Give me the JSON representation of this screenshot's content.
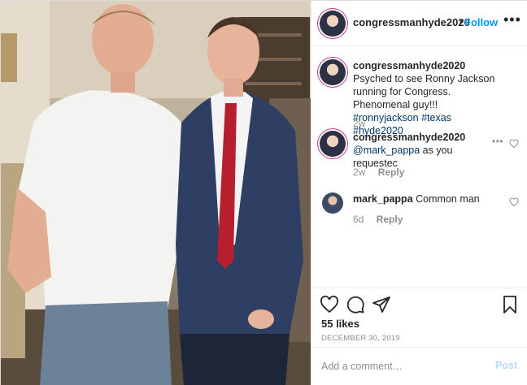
{
  "post": {
    "author": "congressmanhyde2020",
    "separator": "•",
    "follow_label": "Follow",
    "more_label": "•••",
    "photo_alt": "photo"
  },
  "comments": [
    {
      "username": "congressmanhyde2020",
      "text": "Psyched to see Ronny Jackson running for Congress. Phenomenal guy!!!",
      "hashtags": "#ronnyjackson #texas #hyde2020",
      "age": "2w"
    },
    {
      "username": "congressmanhyde2020",
      "mention": "@mark_pappa",
      "text": "as you requestec",
      "age": "2w",
      "reply_label": "Reply",
      "more_label": "•••"
    },
    {
      "username": "mark_pappa",
      "text": "Common man",
      "age": "6d",
      "reply_label": "Reply"
    }
  ],
  "engagement": {
    "likes": "55 likes",
    "date": "DECEMBER 30, 2019"
  },
  "composer": {
    "placeholder": "Add a comment…",
    "post_label": "Post"
  },
  "icons": {
    "like": "heart-icon",
    "comment": "comment-icon",
    "share": "send-icon",
    "save": "bookmark-icon"
  },
  "colors": {
    "accent": "#0095f6",
    "post_disabled": "#b3dbff",
    "hashtag": "#00376b",
    "muted": "#8e8e8e"
  }
}
